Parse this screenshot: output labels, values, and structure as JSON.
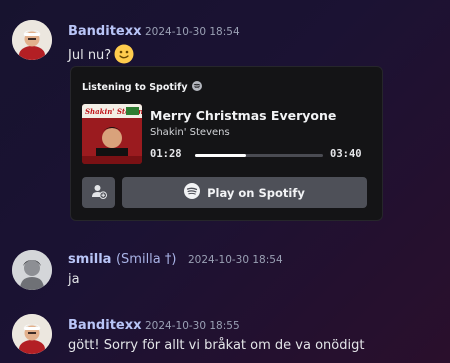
{
  "messages": [
    {
      "author": "Banditexx",
      "alias": "",
      "timestamp": "2024-10-30 18:54",
      "text": "Jul nu?",
      "emoji": "slightly-smiling-face"
    },
    {
      "author": "smilla",
      "alias": "(Smilla †)",
      "timestamp": "2024-10-30 18:54",
      "text": "ja"
    },
    {
      "author": "Banditexx",
      "alias": "",
      "timestamp": "2024-10-30 18:55",
      "text": "gött! Sorry för allt vi bråkat om de va onödigt"
    }
  ],
  "spotify_card": {
    "header": "Listening to Spotify",
    "song_title": "Merry Christmas Everyone",
    "artist": "Shakin' Stevens",
    "elapsed": "01:28",
    "duration": "03:40",
    "progress": 0.4,
    "play_button_label": "Play on Spotify",
    "icons": [
      "spotify-icon",
      "add-friend-icon"
    ]
  },
  "colors": {
    "author_name": "#b9c5f7",
    "card_background": "#141416",
    "button_background": "#4e5058"
  }
}
